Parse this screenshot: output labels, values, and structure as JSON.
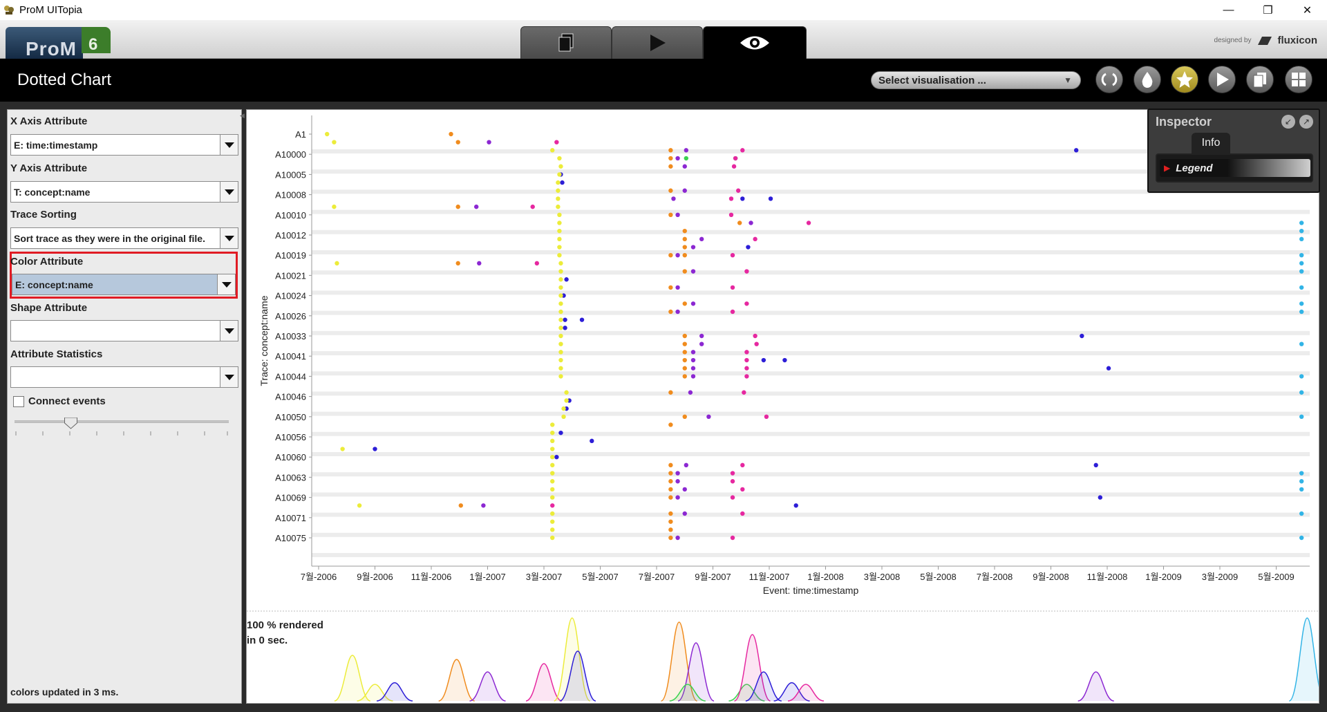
{
  "window": {
    "title": "ProM UITopia",
    "minimize": "—",
    "restore": "❐",
    "close": "✕"
  },
  "header": {
    "logo_text": "ProM",
    "logo_version": "6",
    "designed_by": "designed by",
    "brand": "fluxicon",
    "modes": [
      "workspace",
      "actions",
      "views"
    ],
    "active_mode": "views"
  },
  "toolbar": {
    "view_title": "Dotted Chart",
    "vis_select": "Select visualisation ...",
    "buttons": [
      "refresh-icon",
      "drop-icon",
      "star-icon",
      "play-icon",
      "copy-icon",
      "grid-icon"
    ]
  },
  "left_panel": {
    "x_axis_label": "X Axis Attribute",
    "x_axis_value": "E: time:timestamp",
    "y_axis_label": "Y Axis Attribute",
    "y_axis_value": "T: concept:name",
    "trace_sort_label": "Trace Sorting",
    "trace_sort_value": "Sort trace as they were in the original file.",
    "color_label": "Color Attribute",
    "color_value": "E: concept:name",
    "shape_label": "Shape Attribute",
    "shape_value": "",
    "stats_label": "Attribute Statistics",
    "stats_value": "",
    "connect_label": "Connect events",
    "connect_checked": false,
    "slider_level": 0.25,
    "status": "colors updated in 3 ms."
  },
  "chart": {
    "render_status_1": "100 % rendered",
    "render_status_2": "in 0 sec.",
    "highlight_color": "#e01b24"
  },
  "inspector": {
    "title": "Inspector",
    "tab": "Info",
    "legend_label": "Legend"
  },
  "chart_data": {
    "type": "scatter",
    "xlabel": "Event: time:timestamp",
    "ylabel": "Trace: concept:name",
    "x_ticks": [
      "7월-2006",
      "9월-2006",
      "11월-2006",
      "1월-2007",
      "3월-2007",
      "5월-2007",
      "7월-2007",
      "9월-2007",
      "11월-2007",
      "1월-2008",
      "3월-2008",
      "5월-2008",
      "7월-2008",
      "9월-2008",
      "11월-2008",
      "1월-2009",
      "3월-2009",
      "5월-2009"
    ],
    "y_ticks": [
      "A1",
      "A10000",
      "A10005",
      "A10008",
      "A10010",
      "A10012",
      "A10019",
      "A10021",
      "A10024",
      "A10026",
      "A10033",
      "A10041",
      "A10044",
      "A10046",
      "A10050",
      "A10056",
      "A10060",
      "A10063",
      "A10069",
      "A10071",
      "A10075"
    ],
    "colors": {
      "yellow": "#ecec3a",
      "orange": "#f08c1e",
      "purple": "#8c28d2",
      "magenta": "#e628a0",
      "blue": "#2d1ed7",
      "green": "#3cd250",
      "cyan": "#32b4e6"
    },
    "points": [
      {
        "t": 0.3,
        "y": 0,
        "c": "yellow"
      },
      {
        "t": 0.55,
        "y": 0.4,
        "c": "yellow"
      },
      {
        "t": 4.7,
        "y": 0,
        "c": "orange"
      },
      {
        "t": 4.95,
        "y": 0.4,
        "c": "orange"
      },
      {
        "t": 6.05,
        "y": 0.4,
        "c": "purple"
      },
      {
        "t": 8.45,
        "y": 0.4,
        "c": "magenta"
      },
      {
        "t": 8.3,
        "y": 0.8,
        "c": "yellow"
      },
      {
        "t": 12.5,
        "y": 0.8,
        "c": "orange"
      },
      {
        "t": 13.05,
        "y": 0.8,
        "c": "purple"
      },
      {
        "t": 15.05,
        "y": 0.8,
        "c": "magenta"
      },
      {
        "t": 26.9,
        "y": 0.8,
        "c": "blue"
      },
      {
        "t": 34.9,
        "y": 0.4,
        "c": "cyan"
      },
      {
        "t": 12.5,
        "y": 1.2,
        "c": "orange"
      },
      {
        "t": 12.75,
        "y": 1.2,
        "c": "purple"
      },
      {
        "t": 13.05,
        "y": 1.2,
        "c": "green"
      },
      {
        "t": 14.8,
        "y": 1.2,
        "c": "green"
      },
      {
        "t": 14.8,
        "y": 1.2,
        "c": "magenta"
      },
      {
        "t": 8.55,
        "y": 1.2,
        "c": "yellow"
      },
      {
        "t": 12.5,
        "y": 1.6,
        "c": "orange"
      },
      {
        "t": 13.0,
        "y": 1.6,
        "c": "purple"
      },
      {
        "t": 14.75,
        "y": 1.6,
        "c": "magenta"
      },
      {
        "t": 8.6,
        "y": 1.6,
        "c": "yellow"
      },
      {
        "t": 8.6,
        "y": 2.0,
        "c": "blue"
      },
      {
        "t": 8.55,
        "y": 2.0,
        "c": "yellow"
      },
      {
        "t": 8.65,
        "y": 2.4,
        "c": "blue"
      },
      {
        "t": 8.5,
        "y": 2.4,
        "c": "yellow"
      },
      {
        "t": 8.5,
        "y": 2.8,
        "c": "yellow"
      },
      {
        "t": 12.5,
        "y": 2.8,
        "c": "orange"
      },
      {
        "t": 13.0,
        "y": 2.8,
        "c": "purple"
      },
      {
        "t": 14.9,
        "y": 2.8,
        "c": "magenta"
      },
      {
        "t": 12.6,
        "y": 3.2,
        "c": "purple"
      },
      {
        "t": 14.65,
        "y": 3.2,
        "c": "magenta"
      },
      {
        "t": 15.05,
        "y": 3.2,
        "c": "blue"
      },
      {
        "t": 16.05,
        "y": 3.2,
        "c": "blue"
      },
      {
        "t": 8.5,
        "y": 3.2,
        "c": "yellow"
      },
      {
        "t": 0.55,
        "y": 3.6,
        "c": "yellow"
      },
      {
        "t": 4.95,
        "y": 3.6,
        "c": "orange"
      },
      {
        "t": 5.6,
        "y": 3.6,
        "c": "purple"
      },
      {
        "t": 7.6,
        "y": 3.6,
        "c": "magenta"
      },
      {
        "t": 8.5,
        "y": 3.6,
        "c": "yellow"
      },
      {
        "t": 12.5,
        "y": 4.0,
        "c": "orange"
      },
      {
        "t": 12.75,
        "y": 4.0,
        "c": "purple"
      },
      {
        "t": 14.65,
        "y": 4.0,
        "c": "magenta"
      },
      {
        "t": 8.55,
        "y": 4.0,
        "c": "yellow"
      },
      {
        "t": 14.95,
        "y": 4.4,
        "c": "orange"
      },
      {
        "t": 15.35,
        "y": 4.4,
        "c": "purple"
      },
      {
        "t": 17.4,
        "y": 4.4,
        "c": "magenta"
      },
      {
        "t": 8.55,
        "y": 4.4,
        "c": "yellow"
      },
      {
        "t": 13.0,
        "y": 4.8,
        "c": "orange"
      },
      {
        "t": 8.55,
        "y": 4.8,
        "c": "yellow"
      },
      {
        "t": 34.9,
        "y": 4.4,
        "c": "cyan"
      },
      {
        "t": 34.9,
        "y": 4.8,
        "c": "cyan"
      },
      {
        "t": 13.0,
        "y": 5.2,
        "c": "orange"
      },
      {
        "t": 13.6,
        "y": 5.2,
        "c": "purple"
      },
      {
        "t": 15.5,
        "y": 5.2,
        "c": "magenta"
      },
      {
        "t": 8.55,
        "y": 5.2,
        "c": "yellow"
      },
      {
        "t": 34.9,
        "y": 5.2,
        "c": "cyan"
      },
      {
        "t": 13.0,
        "y": 5.6,
        "c": "orange"
      },
      {
        "t": 13.3,
        "y": 5.6,
        "c": "purple"
      },
      {
        "t": 15.25,
        "y": 5.6,
        "c": "blue"
      },
      {
        "t": 8.55,
        "y": 5.6,
        "c": "yellow"
      },
      {
        "t": 12.5,
        "y": 6.0,
        "c": "orange"
      },
      {
        "t": 12.75,
        "y": 6.0,
        "c": "purple"
      },
      {
        "t": 14.7,
        "y": 6.0,
        "c": "magenta"
      },
      {
        "t": 13.0,
        "y": 6.0,
        "c": "orange"
      },
      {
        "t": 8.55,
        "y": 6.0,
        "c": "yellow"
      },
      {
        "t": 34.9,
        "y": 6.0,
        "c": "cyan"
      },
      {
        "t": 0.65,
        "y": 6.4,
        "c": "yellow"
      },
      {
        "t": 4.95,
        "y": 6.4,
        "c": "orange"
      },
      {
        "t": 5.7,
        "y": 6.4,
        "c": "purple"
      },
      {
        "t": 7.75,
        "y": 6.4,
        "c": "magenta"
      },
      {
        "t": 8.6,
        "y": 6.4,
        "c": "yellow"
      },
      {
        "t": 34.9,
        "y": 6.4,
        "c": "cyan"
      },
      {
        "t": 13.0,
        "y": 6.8,
        "c": "orange"
      },
      {
        "t": 13.3,
        "y": 6.8,
        "c": "purple"
      },
      {
        "t": 15.2,
        "y": 6.8,
        "c": "magenta"
      },
      {
        "t": 8.6,
        "y": 6.8,
        "c": "yellow"
      },
      {
        "t": 34.9,
        "y": 6.8,
        "c": "cyan"
      },
      {
        "t": 8.8,
        "y": 7.2,
        "c": "blue"
      },
      {
        "t": 8.6,
        "y": 7.2,
        "c": "yellow"
      },
      {
        "t": 12.5,
        "y": 7.6,
        "c": "orange"
      },
      {
        "t": 12.75,
        "y": 7.6,
        "c": "purple"
      },
      {
        "t": 14.7,
        "y": 7.6,
        "c": "magenta"
      },
      {
        "t": 8.6,
        "y": 7.6,
        "c": "yellow"
      },
      {
        "t": 34.9,
        "y": 7.6,
        "c": "cyan"
      },
      {
        "t": 8.7,
        "y": 8.0,
        "c": "blue"
      },
      {
        "t": 8.6,
        "y": 8.0,
        "c": "yellow"
      },
      {
        "t": 13.0,
        "y": 8.4,
        "c": "orange"
      },
      {
        "t": 13.3,
        "y": 8.4,
        "c": "purple"
      },
      {
        "t": 15.2,
        "y": 8.4,
        "c": "magenta"
      },
      {
        "t": 8.6,
        "y": 8.4,
        "c": "yellow"
      },
      {
        "t": 34.9,
        "y": 8.4,
        "c": "cyan"
      },
      {
        "t": 12.5,
        "y": 8.8,
        "c": "orange"
      },
      {
        "t": 12.75,
        "y": 8.8,
        "c": "purple"
      },
      {
        "t": 14.7,
        "y": 8.8,
        "c": "magenta"
      },
      {
        "t": 8.6,
        "y": 8.8,
        "c": "yellow"
      },
      {
        "t": 34.9,
        "y": 8.8,
        "c": "cyan"
      },
      {
        "t": 8.75,
        "y": 9.2,
        "c": "blue"
      },
      {
        "t": 9.35,
        "y": 9.2,
        "c": "blue"
      },
      {
        "t": 8.6,
        "y": 9.2,
        "c": "yellow"
      },
      {
        "t": 8.75,
        "y": 9.6,
        "c": "blue"
      },
      {
        "t": 8.6,
        "y": 9.6,
        "c": "yellow"
      },
      {
        "t": 13.0,
        "y": 10.0,
        "c": "orange"
      },
      {
        "t": 13.6,
        "y": 10.0,
        "c": "purple"
      },
      {
        "t": 15.5,
        "y": 10.0,
        "c": "magenta"
      },
      {
        "t": 27.1,
        "y": 10.0,
        "c": "blue"
      },
      {
        "t": 8.6,
        "y": 10.0,
        "c": "yellow"
      },
      {
        "t": 13.0,
        "y": 10.4,
        "c": "orange"
      },
      {
        "t": 13.6,
        "y": 10.4,
        "c": "purple"
      },
      {
        "t": 15.55,
        "y": 10.4,
        "c": "magenta"
      },
      {
        "t": 8.6,
        "y": 10.4,
        "c": "yellow"
      },
      {
        "t": 34.9,
        "y": 10.4,
        "c": "cyan"
      },
      {
        "t": 13.0,
        "y": 10.8,
        "c": "orange"
      },
      {
        "t": 13.3,
        "y": 10.8,
        "c": "purple"
      },
      {
        "t": 15.2,
        "y": 10.8,
        "c": "magenta"
      },
      {
        "t": 15.8,
        "y": 11.2,
        "c": "blue"
      },
      {
        "t": 16.55,
        "y": 11.2,
        "c": "blue"
      },
      {
        "t": 8.6,
        "y": 10.8,
        "c": "yellow"
      },
      {
        "t": 13.0,
        "y": 11.2,
        "c": "orange"
      },
      {
        "t": 13.3,
        "y": 11.2,
        "c": "purple"
      },
      {
        "t": 15.2,
        "y": 11.2,
        "c": "magenta"
      },
      {
        "t": 8.6,
        "y": 11.2,
        "c": "yellow"
      },
      {
        "t": 13.0,
        "y": 11.6,
        "c": "orange"
      },
      {
        "t": 13.3,
        "y": 11.6,
        "c": "purple"
      },
      {
        "t": 15.2,
        "y": 11.6,
        "c": "magenta"
      },
      {
        "t": 28.05,
        "y": 11.6,
        "c": "blue"
      },
      {
        "t": 8.6,
        "y": 11.6,
        "c": "yellow"
      },
      {
        "t": 13.0,
        "y": 12.0,
        "c": "orange"
      },
      {
        "t": 13.3,
        "y": 12.0,
        "c": "purple"
      },
      {
        "t": 15.2,
        "y": 12.0,
        "c": "magenta"
      },
      {
        "t": 8.6,
        "y": 12.0,
        "c": "yellow"
      },
      {
        "t": 34.9,
        "y": 12.0,
        "c": "cyan"
      },
      {
        "t": 12.5,
        "y": 12.8,
        "c": "orange"
      },
      {
        "t": 13.2,
        "y": 12.8,
        "c": "purple"
      },
      {
        "t": 15.1,
        "y": 12.8,
        "c": "magenta"
      },
      {
        "t": 8.8,
        "y": 12.8,
        "c": "yellow"
      },
      {
        "t": 34.9,
        "y": 12.8,
        "c": "cyan"
      },
      {
        "t": 8.9,
        "y": 13.2,
        "c": "blue"
      },
      {
        "t": 8.8,
        "y": 13.6,
        "c": "blue"
      },
      {
        "t": 8.8,
        "y": 13.2,
        "c": "yellow"
      },
      {
        "t": 8.7,
        "y": 13.6,
        "c": "yellow"
      },
      {
        "t": 13.0,
        "y": 14.0,
        "c": "orange"
      },
      {
        "t": 13.85,
        "y": 14.0,
        "c": "purple"
      },
      {
        "t": 15.9,
        "y": 14.0,
        "c": "magenta"
      },
      {
        "t": 8.7,
        "y": 14.0,
        "c": "yellow"
      },
      {
        "t": 34.9,
        "y": 14.0,
        "c": "cyan"
      },
      {
        "t": 12.5,
        "y": 14.4,
        "c": "orange"
      },
      {
        "t": 8.3,
        "y": 14.4,
        "c": "yellow"
      },
      {
        "t": 8.6,
        "y": 14.8,
        "c": "blue"
      },
      {
        "t": 9.7,
        "y": 15.2,
        "c": "blue"
      },
      {
        "t": 8.3,
        "y": 14.8,
        "c": "yellow"
      },
      {
        "t": 8.3,
        "y": 15.2,
        "c": "yellow"
      },
      {
        "t": 0.85,
        "y": 15.6,
        "c": "yellow"
      },
      {
        "t": 2.0,
        "y": 15.6,
        "c": "blue"
      },
      {
        "t": 8.3,
        "y": 15.6,
        "c": "yellow"
      },
      {
        "t": 8.45,
        "y": 16.0,
        "c": "blue"
      },
      {
        "t": 8.3,
        "y": 16.0,
        "c": "yellow"
      },
      {
        "t": 12.5,
        "y": 16.4,
        "c": "orange"
      },
      {
        "t": 13.05,
        "y": 16.4,
        "c": "purple"
      },
      {
        "t": 15.05,
        "y": 16.4,
        "c": "magenta"
      },
      {
        "t": 27.6,
        "y": 16.4,
        "c": "blue"
      },
      {
        "t": 8.3,
        "y": 16.4,
        "c": "yellow"
      },
      {
        "t": 12.5,
        "y": 16.8,
        "c": "orange"
      },
      {
        "t": 12.75,
        "y": 16.8,
        "c": "purple"
      },
      {
        "t": 14.7,
        "y": 16.8,
        "c": "magenta"
      },
      {
        "t": 8.3,
        "y": 16.8,
        "c": "yellow"
      },
      {
        "t": 34.9,
        "y": 16.8,
        "c": "cyan"
      },
      {
        "t": 12.5,
        "y": 17.2,
        "c": "orange"
      },
      {
        "t": 12.75,
        "y": 17.2,
        "c": "purple"
      },
      {
        "t": 14.7,
        "y": 17.2,
        "c": "magenta"
      },
      {
        "t": 8.3,
        "y": 17.2,
        "c": "yellow"
      },
      {
        "t": 34.9,
        "y": 17.2,
        "c": "cyan"
      },
      {
        "t": 12.5,
        "y": 17.6,
        "c": "orange"
      },
      {
        "t": 13.0,
        "y": 17.6,
        "c": "purple"
      },
      {
        "t": 15.05,
        "y": 17.6,
        "c": "magenta"
      },
      {
        "t": 8.3,
        "y": 17.6,
        "c": "yellow"
      },
      {
        "t": 34.9,
        "y": 17.6,
        "c": "cyan"
      },
      {
        "t": 12.5,
        "y": 18.0,
        "c": "orange"
      },
      {
        "t": 12.75,
        "y": 18.0,
        "c": "purple"
      },
      {
        "t": 14.7,
        "y": 18.0,
        "c": "magenta"
      },
      {
        "t": 27.75,
        "y": 18.0,
        "c": "blue"
      },
      {
        "t": 8.3,
        "y": 18.0,
        "c": "yellow"
      },
      {
        "t": 1.45,
        "y": 18.4,
        "c": "yellow"
      },
      {
        "t": 5.05,
        "y": 18.4,
        "c": "orange"
      },
      {
        "t": 5.85,
        "y": 18.4,
        "c": "purple"
      },
      {
        "t": 8.3,
        "y": 18.4,
        "c": "magenta"
      },
      {
        "t": 16.95,
        "y": 18.4,
        "c": "blue"
      },
      {
        "t": 12.5,
        "y": 18.8,
        "c": "orange"
      },
      {
        "t": 13.0,
        "y": 18.8,
        "c": "purple"
      },
      {
        "t": 15.05,
        "y": 18.8,
        "c": "magenta"
      },
      {
        "t": 8.3,
        "y": 18.8,
        "c": "yellow"
      },
      {
        "t": 34.9,
        "y": 18.8,
        "c": "cyan"
      },
      {
        "t": 12.5,
        "y": 19.2,
        "c": "orange"
      },
      {
        "t": 8.3,
        "y": 19.2,
        "c": "yellow"
      },
      {
        "t": 12.5,
        "y": 19.6,
        "c": "orange"
      },
      {
        "t": 8.3,
        "y": 19.6,
        "c": "yellow"
      },
      {
        "t": 12.5,
        "y": 20.0,
        "c": "orange"
      },
      {
        "t": 12.75,
        "y": 20.0,
        "c": "purple"
      },
      {
        "t": 14.7,
        "y": 20.0,
        "c": "magenta"
      },
      {
        "t": 8.3,
        "y": 20.0,
        "c": "yellow"
      },
      {
        "t": 34.9,
        "y": 20.0,
        "c": "cyan"
      }
    ],
    "density": [
      {
        "c": "yellow",
        "peaks": [
          [
            1.2,
            0.55
          ],
          [
            2.0,
            0.2
          ]
        ]
      },
      {
        "c": "blue",
        "peaks": [
          [
            2.7,
            0.22
          ]
        ]
      },
      {
        "c": "orange",
        "peaks": [
          [
            4.9,
            0.5
          ]
        ]
      },
      {
        "c": "purple",
        "peaks": [
          [
            6.0,
            0.35
          ]
        ]
      },
      {
        "c": "magenta",
        "peaks": [
          [
            8.0,
            0.45
          ]
        ]
      },
      {
        "c": "yellow",
        "peaks": [
          [
            9.0,
            1.0
          ]
        ]
      },
      {
        "c": "blue",
        "peaks": [
          [
            9.2,
            0.6
          ]
        ]
      },
      {
        "c": "orange",
        "peaks": [
          [
            12.8,
            0.95
          ]
        ]
      },
      {
        "c": "purple",
        "peaks": [
          [
            13.4,
            0.7
          ]
        ]
      },
      {
        "c": "green",
        "peaks": [
          [
            13.1,
            0.2
          ],
          [
            15.2,
            0.2
          ]
        ]
      },
      {
        "c": "magenta",
        "peaks": [
          [
            15.4,
            0.8
          ]
        ]
      },
      {
        "c": "blue",
        "peaks": [
          [
            15.8,
            0.35
          ],
          [
            16.8,
            0.22
          ]
        ]
      },
      {
        "c": "magenta",
        "peaks": [
          [
            17.3,
            0.2
          ]
        ]
      },
      {
        "c": "purple",
        "peaks": [
          [
            27.6,
            0.35
          ]
        ]
      },
      {
        "c": "cyan",
        "peaks": [
          [
            35.1,
            1.0
          ]
        ]
      }
    ]
  }
}
